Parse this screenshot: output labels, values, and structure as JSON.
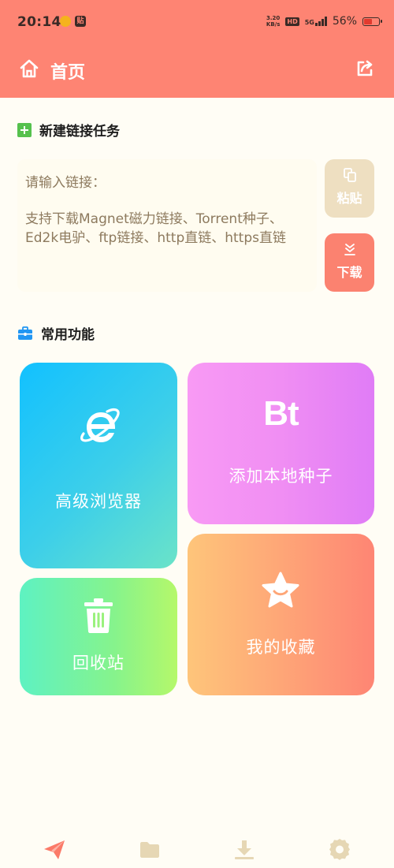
{
  "status_bar": {
    "time": "20:14",
    "notif_badge": "贴",
    "net_speed_value": "3.20",
    "net_speed_unit": "KB/s",
    "hd_label": "HD",
    "network": "5G",
    "battery_percent": "56%",
    "battery_level": 0.56
  },
  "header": {
    "title": "首页"
  },
  "new_task": {
    "heading": "新建链接任务",
    "input_label": "请输入链接：",
    "input_hint": "支持下载Magnet磁力链接、Torrent种子、Ed2k电驴、ftp链接、http直链、https直链",
    "paste_label": "粘贴",
    "download_label": "下载"
  },
  "common": {
    "heading": "常用功能",
    "cards": {
      "browser": "高级浏览器",
      "bt_logo": "Bt",
      "add_seed": "添加本地种子",
      "recycle": "回收站",
      "favorites": "我的收藏"
    }
  },
  "colors": {
    "accent": "#fe8473",
    "paste_button": "#eedfc1",
    "download_button": "#fb8270",
    "background": "#fffdf5",
    "hint_text": "#8d7a5e",
    "tab_icon_active": "#fb7a68",
    "tab_icon_inactive": "#e6d7b4"
  },
  "tabbar": {
    "items": [
      "send-icon",
      "folder-icon",
      "download-icon",
      "settings-icon"
    ]
  }
}
